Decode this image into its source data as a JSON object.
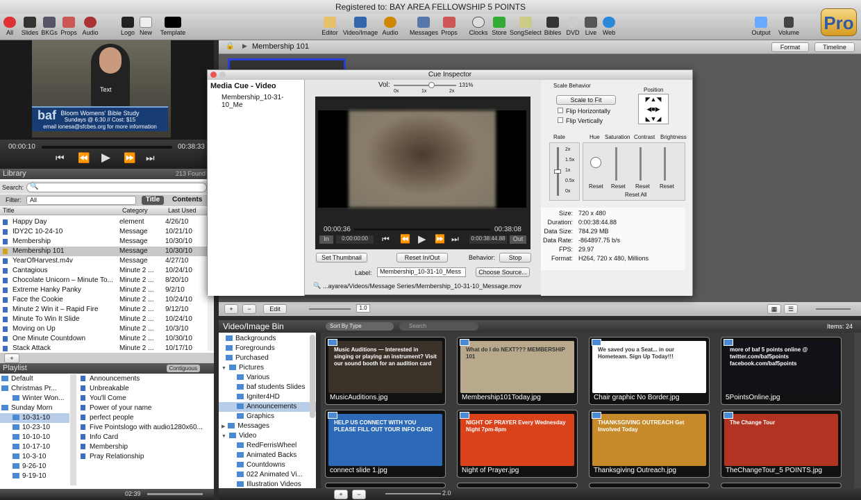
{
  "app": {
    "registered": "Registered to: BAY AREA FELLOWSHIP 5 POINTS"
  },
  "toolbar": {
    "left": [
      "All",
      "Slides",
      "BKGs",
      "Props",
      "Audio",
      "Logo",
      "New",
      "Template"
    ],
    "center": [
      "Editor",
      "Video/Image",
      "Audio",
      "Messages",
      "Props",
      "Clocks",
      "Store",
      "SongSelect",
      "Bibles",
      "DVD",
      "Live",
      "Web"
    ],
    "right": [
      "Output",
      "Volume"
    ],
    "logo": "Pro"
  },
  "preview": {
    "overlay_label": "Text",
    "lower_third": {
      "title": "Bloom Womens' Bible Study",
      "line2": "Sundays @ 6:30 // Cost: $15",
      "line3": "email ionesa@sfcbes.org for more information",
      "logo": "baf"
    },
    "time_elapsed": "00:00:10",
    "time_total": "00:38:33"
  },
  "library": {
    "title": "Library",
    "count": "213 Found",
    "search_label": "Search:",
    "filter_label": "Filter:",
    "filter_value": "All",
    "tab_title": "Title",
    "tab_contents": "Contents",
    "columns": [
      "Title",
      "Category",
      "Last Used"
    ],
    "rows": [
      {
        "title": "Happy Day",
        "category": "element",
        "date": "4/26/10"
      },
      {
        "title": "IDY2C 10-24-10",
        "category": "Message",
        "date": "10/21/10"
      },
      {
        "title": "Membership",
        "category": "Message",
        "date": "10/30/10"
      },
      {
        "title": "Membership 101",
        "category": "Message",
        "date": "10/30/10"
      },
      {
        "title": "YearOfHarvest.m4v",
        "category": "Message",
        "date": "4/27/10"
      },
      {
        "title": "Cantagious",
        "category": "Minute 2 ...",
        "date": "10/24/10"
      },
      {
        "title": "Chocolate Unicorn – Minute To...",
        "category": "Minute 2 ...",
        "date": "8/20/10"
      },
      {
        "title": "Extreme Hanky Panky",
        "category": "Minute 2 ...",
        "date": "9/2/10"
      },
      {
        "title": "Face the Cookie",
        "category": "Minute 2 ...",
        "date": "10/24/10"
      },
      {
        "title": "Minute 2 Win it – Rapid Fire",
        "category": "Minute 2 ...",
        "date": "9/12/10"
      },
      {
        "title": "Minute To Win It Slide",
        "category": "Minute 2 ...",
        "date": "10/24/10"
      },
      {
        "title": "Moving on Up",
        "category": "Minute 2 ...",
        "date": "10/3/10"
      },
      {
        "title": "One Minute Countdown",
        "category": "Minute 2 ...",
        "date": "10/30/10"
      },
      {
        "title": "Stack Attack",
        "category": "Minute 2 ...",
        "date": "10/17/10"
      }
    ]
  },
  "playlist": {
    "title": "Playlist",
    "contiguous": "Contiguous",
    "tree": [
      "Default",
      "Christmas Pr...",
      "Winter Won...",
      "Sunday Morn",
      "10-31-10",
      "10-23-10",
      "10-10-10",
      "10-17-10",
      "10-3-10",
      "9-26-10",
      "9-19-10"
    ],
    "items": [
      "Announcements",
      "Unbreakable",
      "You'll Come",
      "Power of your name",
      "perfect people",
      "Five Pointslogo with audio1280x60...",
      "Info Card",
      "Membership",
      "Pray Relationship"
    ],
    "time": "02:39"
  },
  "main": {
    "breadcrumb": "Membership 101",
    "format": "Format",
    "timeline": "Timeline",
    "edit": "Edit",
    "zoom": "1.0"
  },
  "cue": {
    "title": "Cue Inspector",
    "panel_title": "Media Cue - Video",
    "item": "Membership_10-31-10_Me",
    "vol_label": "Vol:",
    "vol_value": "131%",
    "vol_ticks": [
      "0x",
      "1x",
      "2x"
    ],
    "time_current": "00:00:36",
    "time_total": "00:38:08",
    "in": "In",
    "in_time": "0:00:00:00",
    "out_time": "0:00:38:44.88",
    "out": "Out",
    "set_thumbnail": "Set Thumbnail",
    "reset_inout": "Reset In/Out",
    "behavior_label": "Behavior:",
    "behavior": "Stop",
    "label_label": "Label:",
    "label_value": "Membership_10-31-10_Mess",
    "choose_source": "Choose Source...",
    "path": "...ayarea/Videos/Message Series/Membership_10-31-10_Message.mov",
    "scale_title": "Scale Behavior",
    "scale_value": "Scale to Fit",
    "flip_h": "Flip Horizontally",
    "flip_v": "Flip Vertically",
    "position": "Position",
    "rate": "Rate",
    "rate_ticks": [
      "2x",
      "1.5x",
      "1x",
      "0.5x",
      "0x"
    ],
    "hue": "Hue",
    "saturation": "Saturation",
    "contrast": "Contrast",
    "brightness": "Brightness",
    "reset": "Reset",
    "reset_all": "Reset All",
    "info": [
      [
        "Size:",
        "720 x 480"
      ],
      [
        "Duration:",
        "0:00:38:44.88"
      ],
      [
        "Data Size:",
        "784.29 MB"
      ],
      [
        "Data Rate:",
        "-864897.75 b/s"
      ],
      [
        "FPS:",
        "29.97"
      ],
      [
        "Format:",
        "H264, 720 x 480, Millions"
      ]
    ]
  },
  "bin": {
    "title": "Video/Image Bin",
    "sort": "Sort By Type",
    "search": "Search",
    "items_count": "Items: 24",
    "zoom": "2.0",
    "tree": [
      {
        "label": "Backgrounds",
        "level": 1
      },
      {
        "label": "Foregrounds",
        "level": 1
      },
      {
        "label": "Purchased",
        "level": 1
      },
      {
        "label": "Pictures",
        "level": 0
      },
      {
        "label": "Various",
        "level": 2
      },
      {
        "label": "baf students Slides",
        "level": 2
      },
      {
        "label": "Igniter4HD",
        "level": 2
      },
      {
        "label": "Announcements",
        "level": 2
      },
      {
        "label": "Graphics",
        "level": 2
      },
      {
        "label": "Messages",
        "level": 0
      },
      {
        "label": "Video",
        "level": 0
      },
      {
        "label": "RedFerrisWheel",
        "level": 2
      },
      {
        "label": "Animated Backs",
        "level": 2
      },
      {
        "label": "Countdowns",
        "level": 2
      },
      {
        "label": "022 Animated Vi...",
        "level": 2
      },
      {
        "label": "Illustration Videos",
        "level": 2
      }
    ],
    "tiles": [
      {
        "caption": "MusicAuditions.jpg",
        "text": "Music Auditions — Interested in singing or playing an instrument? Visit our sound booth for an audition card",
        "bg": "#3a3228"
      },
      {
        "caption": "Membership101Today.jpg",
        "text": "What do I do NEXT??? MEMBERSHIP 101",
        "bg": "#b9a98c"
      },
      {
        "caption": "Chair graphic No Border.jpg",
        "text": "We saved you a Seat... in our Hometeam. Sign Up Today!!!",
        "bg": "#ffffff"
      },
      {
        "caption": "5PointsOnline.jpg",
        "text": "more of baf 5 points online @ twitter.com/baf5points facebook.com/baf5points",
        "bg": "#101218"
      },
      {
        "caption": "connect slide 1.jpg",
        "text": "HELP US CONNECT WITH YOU PLEASE FILL OUT YOUR INFO CARD",
        "bg": "#2c6ab8"
      },
      {
        "caption": "Night of Prayer.jpg",
        "text": "NIGHT OF PRAYER Every Wednesday Night 7pm-8pm",
        "bg": "#d9421b"
      },
      {
        "caption": "Thanksgiving Outreach.jpg",
        "text": "THANKSGIVING OUTREACH Get Involved Today",
        "bg": "#c78a2a"
      },
      {
        "caption": "TheChangeTour_5 POINTS.jpg",
        "text": "The Change Tour",
        "bg": "#b23322"
      }
    ]
  }
}
